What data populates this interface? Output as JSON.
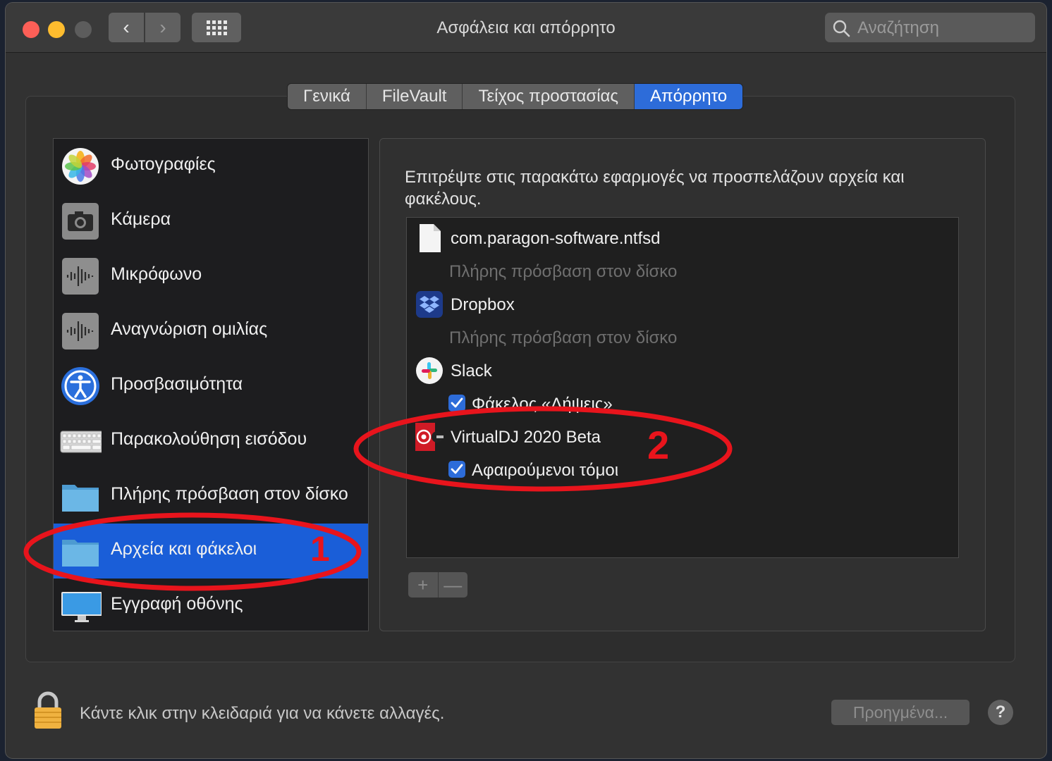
{
  "window": {
    "title": "Ασφάλεια και απόρρητο"
  },
  "toolbar": {
    "back_glyph": "‹",
    "forward_glyph": "›",
    "grid_icon": "grid-icon"
  },
  "search": {
    "placeholder": "Αναζήτηση",
    "icon": "search-icon"
  },
  "tabs": [
    {
      "label": "Γενικά",
      "active": false
    },
    {
      "label": "FileVault",
      "active": false
    },
    {
      "label": "Τείχος προστασίας",
      "active": false
    },
    {
      "label": "Απόρρητο",
      "active": true
    }
  ],
  "sidebar": {
    "items": [
      {
        "label": "Φωτογραφίες",
        "icon": "photos-icon"
      },
      {
        "label": "Κάμερα",
        "icon": "camera-icon"
      },
      {
        "label": "Μικρόφωνο",
        "icon": "microphone-icon"
      },
      {
        "label": "Αναγνώριση ομιλίας",
        "icon": "speech-recognition-icon"
      },
      {
        "label": "Προσβασιμότητα",
        "icon": "accessibility-icon"
      },
      {
        "label": "Παρακολούθηση εισόδου",
        "icon": "keyboard-icon"
      },
      {
        "label": "Πλήρης πρόσβαση στον δίσκο",
        "icon": "folder-icon"
      },
      {
        "label": "Αρχεία και φάκελοι",
        "icon": "folder-icon",
        "selected": true
      },
      {
        "label": "Εγγραφή οθόνης",
        "icon": "display-icon"
      }
    ]
  },
  "panel": {
    "description": "Επιτρέψτε στις παρακάτω εφαρμογές να προσπελάζουν αρχεία και φακέλους.",
    "apps": [
      {
        "name": "com.paragon-software.ntfsd",
        "icon": "document-icon",
        "permission": "Πλήρης πρόσβαση στον δίσκο",
        "checkbox": false
      },
      {
        "name": "Dropbox",
        "icon": "dropbox-icon",
        "permission": "Πλήρης πρόσβαση στον δίσκο",
        "checkbox": false
      },
      {
        "name": "Slack",
        "icon": "slack-icon",
        "permission": "Φάκελος «Λήψεις»",
        "checkbox": true
      },
      {
        "name": "VirtualDJ 2020 Beta",
        "icon": "virtualdj-icon",
        "permission": "Αφαιρούμενοι τόμοι",
        "checkbox": true
      }
    ],
    "add_label": "+",
    "remove_label": "—"
  },
  "footer": {
    "lock_text": "Κάντε κλικ στην κλειδαριά για να κάνετε αλλαγές.",
    "advanced_label": "Προηγμένα...",
    "help_label": "?"
  },
  "annotations": {
    "label_1": "1",
    "label_2": "2",
    "color": "#e8141c"
  },
  "colors": {
    "accent": "#2d6cd9",
    "selection": "#1a5ed8",
    "window_bg": "#323232"
  }
}
